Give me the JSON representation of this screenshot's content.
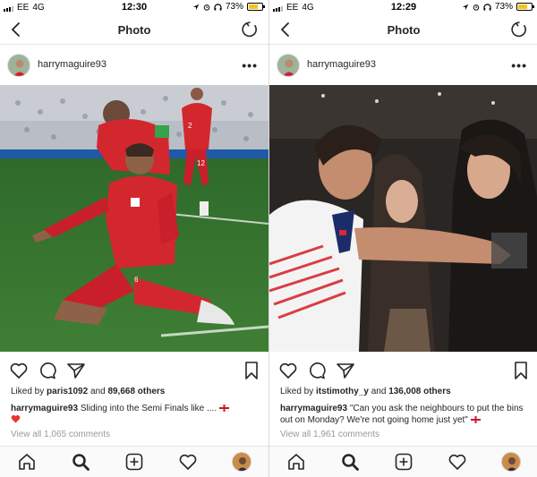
{
  "status_bar": {
    "carrier": "EE",
    "network": "4G",
    "battery": "73%",
    "battery_level": 0.73
  },
  "nav": {
    "title": "Photo"
  },
  "colors": {
    "text": "#262626",
    "muted": "#999999",
    "heart_red": "#e8342e",
    "accent_green": "#2f6b2e"
  },
  "icons": {
    "back": "chevron-left-icon",
    "refresh": "refresh-icon",
    "more": "more-dots-icon",
    "like": "heart-icon",
    "comment": "comment-icon",
    "share": "send-icon",
    "save": "bookmark-icon",
    "home": "home-icon",
    "search": "search-icon",
    "new_post": "add-post-icon",
    "activity": "heart-outline-icon",
    "flag": "england-flag-icon"
  },
  "panels": [
    {
      "status_time": "12:30",
      "username": "harrymaguire93",
      "likes_prefix": "Liked by",
      "liked_by": "paris1092",
      "likes_and": "and",
      "likes_count": "89,668 others",
      "caption_user": "harrymaguire93",
      "caption_text": "Sliding into the Semi Finals like ....",
      "view_comments": "View all 1,065 comments"
    },
    {
      "status_time": "12:29",
      "username": "harrymaguire93",
      "likes_prefix": "Liked by",
      "liked_by": "itstimothy_y",
      "likes_and": "and",
      "likes_count": "136,008 others",
      "caption_user": "harrymaguire93",
      "caption_text": "\"Can you ask the neighbours to put the bins out on Monday? We're not going home just yet\"",
      "view_comments": "View all 1,961 comments"
    }
  ]
}
